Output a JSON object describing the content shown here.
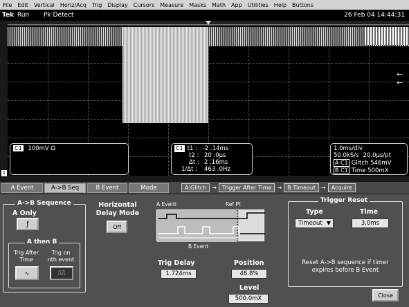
{
  "menu": [
    "File",
    "Edit",
    "Vertical",
    "Horiz/Acq",
    "Trig",
    "Display",
    "Cursors",
    "Measure",
    "Masks",
    "Math",
    "App",
    "Utilities",
    "Help",
    "Buttons"
  ],
  "status": {
    "brand": "Tek",
    "run": "Run",
    "mode": "Pk Detect",
    "datetime": "26 Feb 04 14:44:31"
  },
  "scope": {
    "ch_marker": "1",
    "ch1_readout": {
      "ch": "C1",
      "scale": "100mV Ω"
    },
    "cursors": {
      "ch": "C1",
      "t1_label": "t1 :",
      "t1": "-2 .14ms",
      "t2_label": "t2 :",
      "t2": "20 .0µs",
      "dt_label": "Δt :",
      "dt": "2 .16ms",
      "inv_label": "1/Δt :",
      "inv": "463 .0Hz"
    },
    "timebase": {
      "div": "1.0ms/div",
      "rate": "50.0kS/s",
      "pt": "20.0µs/pt",
      "a_ch": "A C1",
      "a_info": "Glitch  546mV",
      "b_ch": "B C1",
      "b_info": "Time  500mX"
    }
  },
  "tabs": [
    "A Event",
    "A->B Seq",
    "B Event",
    "Mode"
  ],
  "sequence": {
    "a": "A:Glitch",
    "arrow1": "→",
    "mid": "Trigger After Time",
    "arrow2": "→",
    "b": "B:Timeout",
    "arrow3": "→",
    "end": "Acquire"
  },
  "panel": {
    "ab_title": "A->B Sequence",
    "a_only": "A Only",
    "a_then_b": "A then B",
    "trig_after": "Trig After\nTime",
    "trig_nth": "Trig on\nnth event",
    "hdm_title": "Horizontal\nDelay Mode",
    "hdm_value": "Off",
    "diag": {
      "a_event": "A Event",
      "ref_pt": "Ref Pt",
      "b_event": "B Event"
    },
    "trig_delay_label": "Trig Delay",
    "trig_delay": "1.724ms",
    "position_label": "Position",
    "position": "46.8%",
    "level_label": "Level",
    "level": "500.0mX",
    "reset_title": "Trigger Reset",
    "type_label": "Type",
    "type_value": "Timeout",
    "time_label": "Time",
    "time_value": "3.0ms",
    "reset_note": "Reset A->B sequence if timer\nexpires before B Event",
    "close": "Close"
  }
}
